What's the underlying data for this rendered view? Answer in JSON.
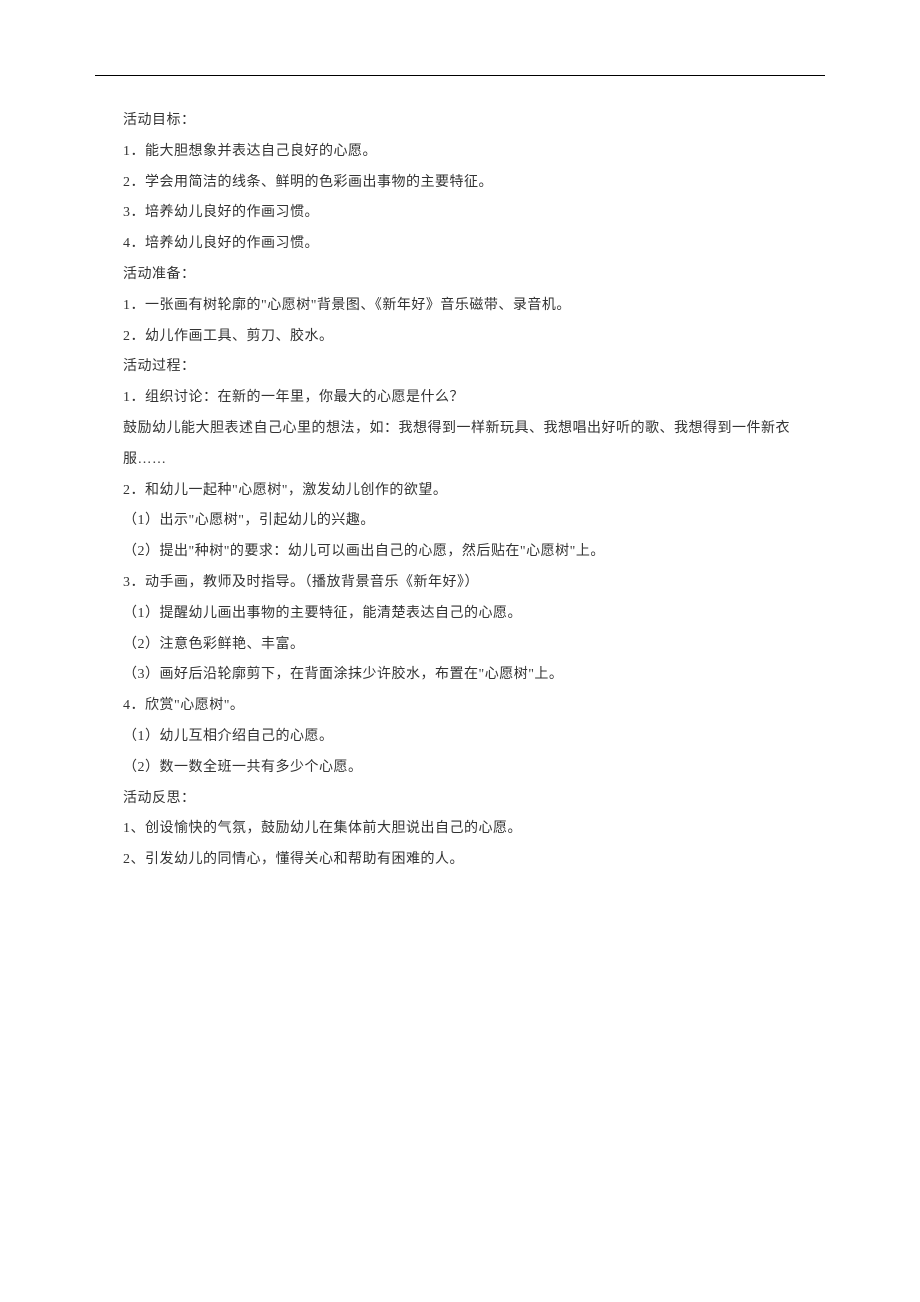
{
  "lines": [
    "活动目标：",
    "1．能大胆想象并表达自己良好的心愿。",
    "2．学会用简洁的线条、鲜明的色彩画出事物的主要特征。",
    "3．培养幼儿良好的作画习惯。",
    "4．培养幼儿良好的作画习惯。",
    "活动准备：",
    "1．一张画有树轮廓的\"心愿树\"背景图、《新年好》音乐磁带、录音机。",
    "2．幼儿作画工具、剪刀、胶水。",
    "活动过程：",
    "1．组织讨论：在新的一年里，你最大的心愿是什么？"
  ],
  "long_line": "鼓励幼儿能大胆表述自己心里的想法，如：我想得到一样新玩具、我想唱出好听的歌、我想得到一件新衣服……",
  "lines2": [
    "2．和幼儿一起种\"心愿树\"，激发幼儿创作的欲望。",
    "（1）出示\"心愿树\"，引起幼儿的兴趣。",
    "（2）提出\"种树\"的要求：幼儿可以画出自己的心愿，然后贴在\"心愿树\"上。",
    "3．动手画，教师及时指导。（播放背景音乐《新年好》）",
    "（1）提醒幼儿画出事物的主要特征，能清楚表达自己的心愿。",
    "（2）注意色彩鲜艳、丰富。",
    "（3）画好后沿轮廓剪下，在背面涂抹少许胶水，布置在\"心愿树\"上。",
    "4．欣赏\"心愿树\"。",
    "（1）幼儿互相介绍自己的心愿。",
    "（2）数一数全班一共有多少个心愿。",
    "活动反思：",
    "1、创设愉快的气氛，鼓励幼儿在集体前大胆说出自己的心愿。",
    "2、引发幼儿的同情心，懂得关心和帮助有困难的人。"
  ]
}
